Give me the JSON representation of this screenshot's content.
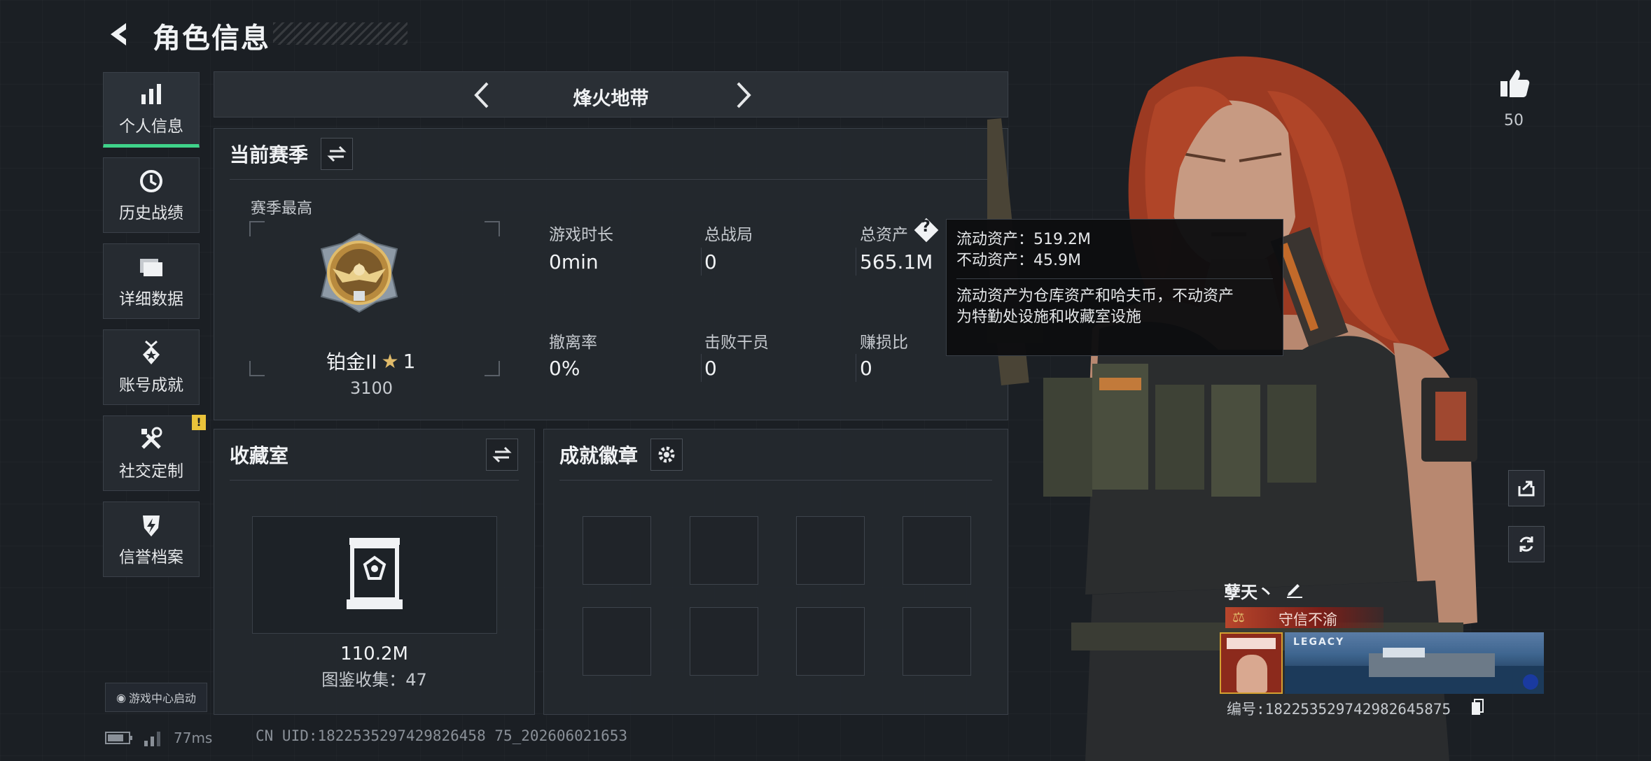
{
  "header": {
    "title": "角色信息"
  },
  "sidebar": {
    "items": [
      {
        "label": "个人信息",
        "icon": "bar-chart-icon",
        "active": true
      },
      {
        "label": "历史战绩",
        "icon": "history-icon"
      },
      {
        "label": "详细数据",
        "icon": "folder-icon"
      },
      {
        "label": "账号成就",
        "icon": "achievement-icon"
      },
      {
        "label": "社交定制",
        "icon": "tools-icon",
        "badge": "!"
      },
      {
        "label": "信誉档案",
        "icon": "shield-icon"
      }
    ],
    "launch_label": "游戏中心启动"
  },
  "mode": {
    "title": "烽火地带"
  },
  "season": {
    "title": "当前赛季",
    "best_label": "赛季最高",
    "rank_name": "铂金II",
    "rank_stars": "1",
    "rank_points": "3100",
    "stats": [
      {
        "label": "游戏时长",
        "value": "0min"
      },
      {
        "label": "总战局",
        "value": "0"
      },
      {
        "label": "总资产",
        "value": "565.1M"
      },
      {
        "label": "撤离率",
        "value": "0%"
      },
      {
        "label": "击败干员",
        "value": "0"
      },
      {
        "label": "赚损比",
        "value": "0"
      }
    ]
  },
  "tooltip": {
    "liquid": "流动资产：519.2M",
    "fixed": "不动资产：45.9M",
    "desc_1": "流动资产为仓库资产和哈夫币，不动资产",
    "desc_2": "为特勤处设施和收藏室设施"
  },
  "collection": {
    "title": "收藏室",
    "value": "110.2M",
    "count": "图鉴收集：47"
  },
  "badges": {
    "title": "成就徽章"
  },
  "social": {
    "like_count": "50"
  },
  "player": {
    "name": "孽天丶",
    "reputation": "守信不渝",
    "card_text": "LEGACY",
    "id": "编号:1822535297429826458​75"
  },
  "status": {
    "ping": "77ms",
    "uid": "CN UID:1822535297429826458 75_202606021653"
  },
  "colors": {
    "accent": "#3fd38a",
    "warning": "#e9c23a",
    "reputation": "#b8462c"
  }
}
